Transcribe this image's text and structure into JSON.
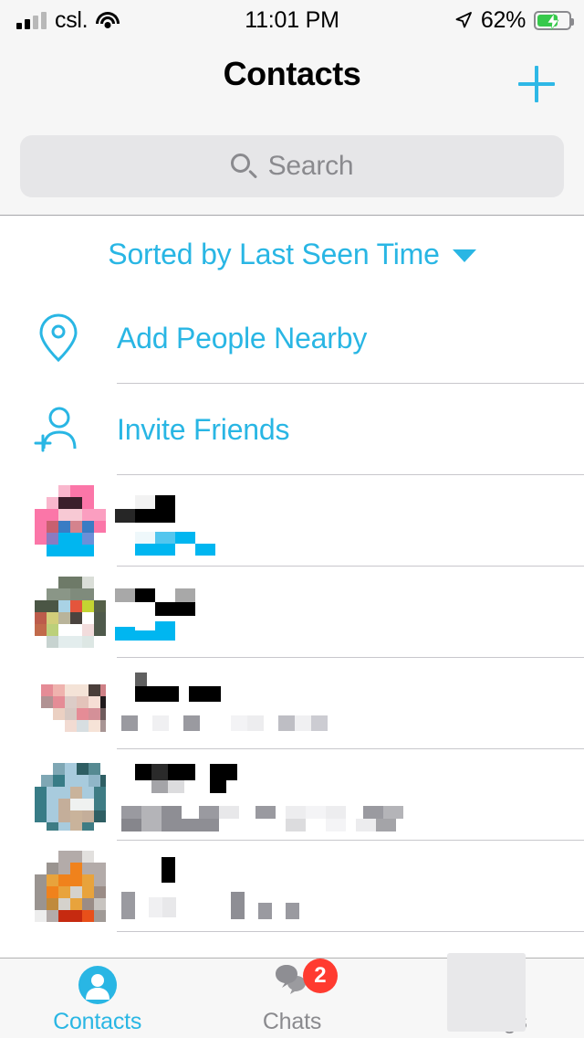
{
  "status_bar": {
    "carrier": "csl.",
    "time": "11:01 PM",
    "battery_percent": "62%",
    "signal_icon": "cellular-bars-icon",
    "wifi_icon": "wifi-icon",
    "location_icon": "location-arrow-icon",
    "battery_icon": "battery-charging-icon"
  },
  "navbar": {
    "title": "Contacts",
    "add_icon": "plus-icon"
  },
  "search": {
    "placeholder": "Search",
    "icon": "search-icon"
  },
  "sort": {
    "label": "Sorted by Last Seen Time",
    "caret_icon": "chevron-down-icon"
  },
  "actions": [
    {
      "label": "Add People Nearby",
      "icon": "location-pin-icon"
    },
    {
      "label": "Invite Friends",
      "icon": "add-person-icon"
    }
  ],
  "contacts": [
    {
      "name": "",
      "status": "",
      "redacted": true,
      "avatar_palette": [
        "#F9B7CD",
        "#FB76A8",
        "#3B1F2B",
        "#F7C9D4",
        "#C96070",
        "#3A7CC4",
        "#00B6F0",
        "#8C7BC0"
      ]
    },
    {
      "name": "",
      "status": "",
      "redacted": true,
      "avatar_palette": [
        "#6E7A68",
        "#8A9687",
        "#DADED8",
        "#A9D2E5",
        "#E4553C",
        "#C3D432",
        "#556048",
        "#BC5C4B",
        "#D2CE7A",
        "#FFFFFF"
      ]
    },
    {
      "name": "",
      "status": "",
      "redacted": true,
      "avatar_palette": [
        "#E58C96",
        "#EFB3AE",
        "#F4E3D7",
        "#4A3E3A",
        "#CE8086",
        "#B19293",
        "#201A1C",
        "#E8C9C3"
      ]
    },
    {
      "name": "",
      "status": "",
      "redacted": true,
      "avatar_palette": [
        "#7FA7B4",
        "#A8CBDD",
        "#2E5E63",
        "#387C86",
        "#C9B39B",
        "#EFF1F0",
        "#6A9AAC"
      ]
    },
    {
      "name": "",
      "status": "",
      "redacted": true,
      "avatar_palette": [
        "#B3ABA9",
        "#F0821C",
        "#E8A33C",
        "#D5D2CC",
        "#9A8C86",
        "#C62A10",
        "#E8501A",
        "#A09A96"
      ]
    }
  ],
  "tabbar": {
    "items": [
      {
        "label": "Contacts",
        "icon": "person-filled-icon",
        "active": true,
        "badge": ""
      },
      {
        "label": "Chats",
        "icon": "chat-bubbles-icon",
        "active": false,
        "badge": "2"
      },
      {
        "label": "Settings",
        "icon": "settings-icon",
        "active": false,
        "badge": ""
      }
    ]
  },
  "colors": {
    "accent": "#29B6E4",
    "badge": "#FF3B30",
    "header_bg": "#F6F6F6",
    "search_bg": "#E6E6E8",
    "separator": "#C8C7CC",
    "inactive_tab": "#8A8A8E"
  }
}
